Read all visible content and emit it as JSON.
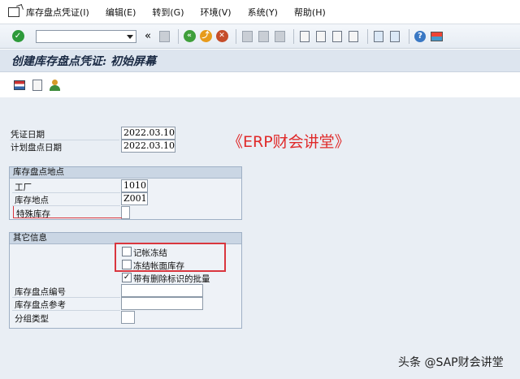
{
  "menu": {
    "items": [
      "库存盘点凭证(I)",
      "编辑(E)",
      "转到(G)",
      "环境(V)",
      "系统(Y)",
      "帮助(H)"
    ]
  },
  "toolbar": {
    "command_value": "",
    "icons": [
      "check-icon",
      "back-icon",
      "exit-icon",
      "cancel-icon",
      "print-icon",
      "find-icon",
      "help-icon",
      "monitor-icon"
    ]
  },
  "page": {
    "title": "创建库存盘点凭证: 初始屏幕"
  },
  "header_fields": {
    "doc_date_label": "凭证日期",
    "doc_date_value": "2022.03.10",
    "plan_date_label": "计划盘点日期",
    "plan_date_value": "2022.03.10"
  },
  "watermark": "《ERP财会讲堂》",
  "group_location": {
    "title": "库存盘点地点",
    "plant_label": "工厂",
    "plant_value": "1010",
    "storage_label": "库存地点",
    "storage_value": "Z001",
    "special_stock_label": "特殊库存",
    "special_stock_value": ""
  },
  "group_other": {
    "title": "其它信息",
    "posting_block_label": "记帐冻结",
    "posting_block_checked": false,
    "freeze_book_label": "冻结帐面库存",
    "freeze_book_checked": false,
    "with_deletion_label": "带有删除标识的批量",
    "with_deletion_checked": true,
    "doc_number_label": "库存盘点编号",
    "doc_number_value": "",
    "doc_ref_label": "库存盘点参考",
    "doc_ref_value": "",
    "group_type_label": "分组类型",
    "group_type_value": ""
  },
  "footer": {
    "brand": "头条 @SAP财会讲堂"
  }
}
